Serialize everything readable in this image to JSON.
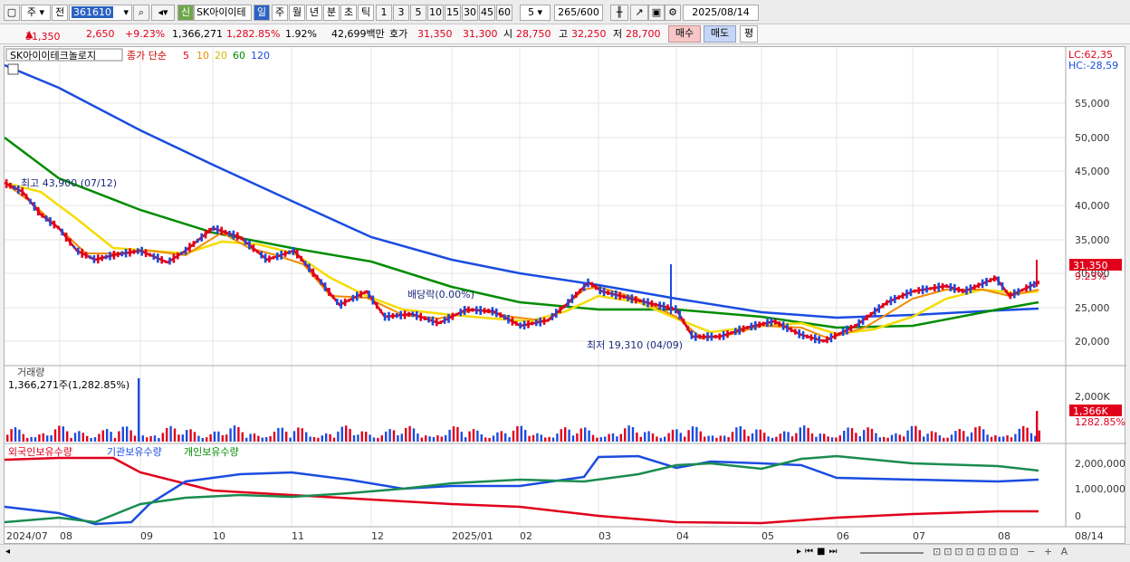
{
  "toolbar": {
    "item_type": "주",
    "market": "전",
    "code": "361610",
    "name": "SK아이이테",
    "period_active": "일",
    "periods": [
      "주",
      "월",
      "년",
      "분",
      "초",
      "틱"
    ],
    "intervals": [
      "1",
      "3",
      "5",
      "10",
      "15",
      "30",
      "45",
      "60"
    ],
    "interval_value": "5",
    "count_value": "265",
    "count_total": "/600",
    "date": "2025/08/14",
    "new_badge": "신"
  },
  "price_bar": {
    "price": "31,350",
    "change": "2,650",
    "change_pct": "+9.23%",
    "volume": "1,366,271",
    "volume_ratio": "1,282.85%",
    "turnover": "1.92%",
    "amount": "42,699백만",
    "quote_label": "호가",
    "ask": "31,350",
    "bid": "31,300",
    "open_label": "시",
    "open": "28,750",
    "high_label": "고",
    "high": "32,250",
    "low_label": "저",
    "low": "28,700",
    "buy": "매수",
    "sell": "매도",
    "eval": "평"
  },
  "price_pane": {
    "stock_label": "SK아이이테크놀로지",
    "ma_label": "종가 단순",
    "ma": [
      "5",
      "10",
      "20",
      "60",
      "120"
    ],
    "ma_colors": [
      "#e0001b",
      "#f08c00",
      "#f5dc00",
      "#008c00",
      "#1a4ce0"
    ],
    "lc": "LC:62,35",
    "hc": "HC:-28,59",
    "high_note": "최고 43,900 (07/12)",
    "low_note": "최저 19,310 (04/09)",
    "dividend_note": "배당락(0.00%)",
    "current_tag": "31,350",
    "current_pct": "9.23%",
    "yticks": [
      "55,000",
      "50,000",
      "45,000",
      "40,000",
      "35,000",
      "30,000",
      "25,000",
      "20,000"
    ]
  },
  "volume_pane": {
    "title": "거래량",
    "info": "1,366,271주(1,282.85%)",
    "ytick": "2,000K",
    "current_tag": "1,366K",
    "current_pct": "1282.85%"
  },
  "holding_pane": {
    "legend": [
      "외국인보유수량",
      "기관보유수량",
      "개인보유수량"
    ],
    "yticks": [
      "2,000,000",
      "1,000,000",
      "0"
    ]
  },
  "xaxis": [
    "2024/07",
    "08",
    "09",
    "10",
    "11",
    "12",
    "2025/01",
    "02",
    "03",
    "04",
    "05",
    "06",
    "07",
    "08"
  ],
  "xaxis_right": "08/14"
}
